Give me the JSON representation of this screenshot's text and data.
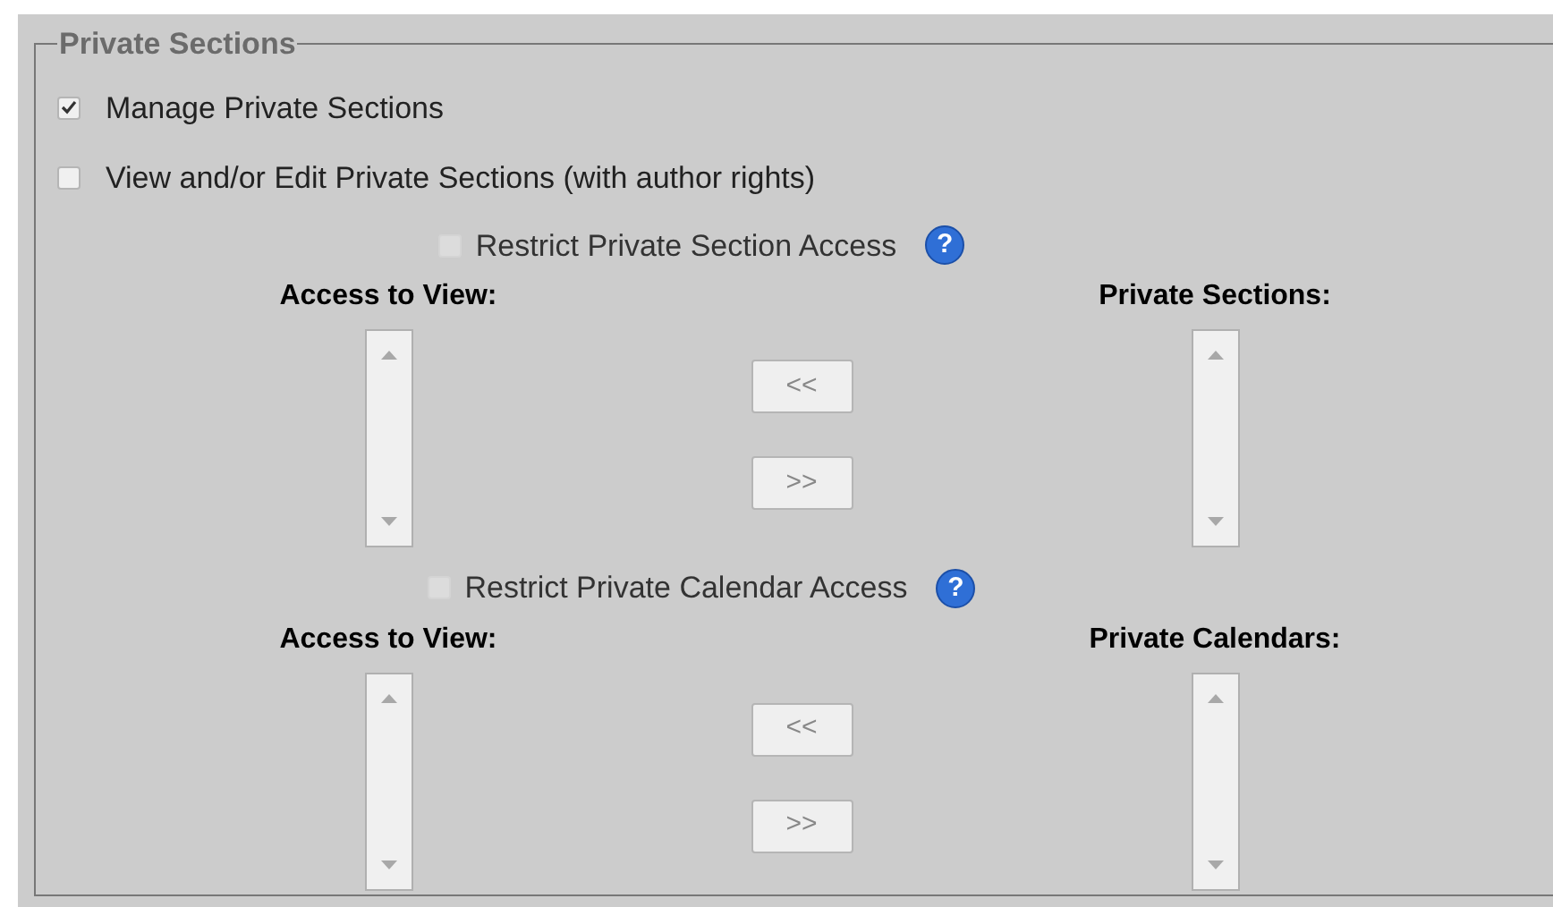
{
  "legend": "Private Sections",
  "options": [
    {
      "label": "Manage Private Sections",
      "checked": true
    },
    {
      "label": "View and/or Edit Private Sections (with author rights)",
      "checked": false
    }
  ],
  "groups": [
    {
      "restrict": {
        "label": "Restrict Private Section Access",
        "checked": false,
        "disabled": true
      },
      "help": "?",
      "left_header": "Access to View:",
      "right_header": "Private Sections:",
      "buttons": [
        "<<",
        ">>"
      ]
    },
    {
      "restrict": {
        "label": "Restrict Private Calendar Access",
        "checked": false,
        "disabled": true
      },
      "help": "?",
      "left_header": "Access to View:",
      "right_header": "Private Calendars:",
      "buttons": [
        "<<",
        ">>"
      ]
    }
  ]
}
